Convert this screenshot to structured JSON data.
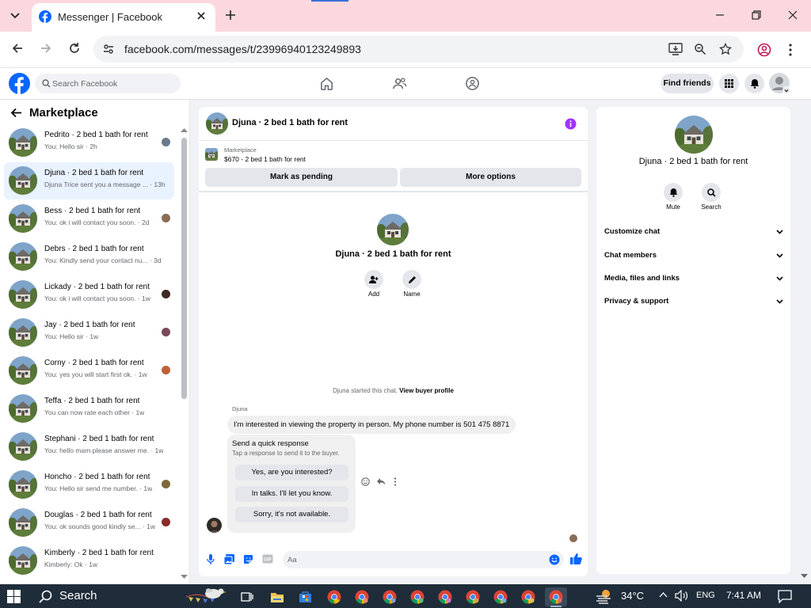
{
  "browser": {
    "tab_title": "Messenger | Facebook",
    "url": "facebook.com/messages/t/23996940123249893"
  },
  "fb_header": {
    "search_placeholder": "Search Facebook",
    "find_friends": "Find friends"
  },
  "sidebar": {
    "title": "Marketplace",
    "conversations": [
      {
        "name": "Pedrito · 2 bed 1 bath for rent",
        "preview": "You: Hello sir · 2h",
        "mini_color": "#6b7a8a"
      },
      {
        "name": "Djuna · 2 bed 1 bath for rent",
        "preview": "Djuna Trice sent you a message ... · 13h",
        "mini_color": ""
      },
      {
        "name": "Bess · 2 bed 1 bath for rent",
        "preview": "You: ok i will contact you soon. · 2d",
        "mini_color": "#8a6d56"
      },
      {
        "name": "Debrs · 2 bed 1 bath for rent",
        "preview": "You: Kindly send your contact nu... · 3d",
        "mini_color": ""
      },
      {
        "name": "Lickady · 2 bed 1 bath for rent",
        "preview": "You: ok i will contact you soon. · 1w",
        "mini_color": "#3d2a22"
      },
      {
        "name": "Jay · 2 bed 1 bath for rent",
        "preview": "You: Hello sir · 1w",
        "mini_color": "#7a4a5a"
      },
      {
        "name": "Corny · 2 bed 1 bath for rent",
        "preview": "You: yes you will start first ok. · 1w",
        "mini_color": "#c0603a"
      },
      {
        "name": "Teffa · 2 bed 1 bath for rent",
        "preview": "You can now rate each other · 1w",
        "mini_color": ""
      },
      {
        "name": "Stephani · 2 bed 1 bath for rent",
        "preview": "You: hello mam please answer me. · 1w",
        "mini_color": ""
      },
      {
        "name": "Honcho · 2 bed 1 bath for rent",
        "preview": "You: Hello sir send me number. · 1w",
        "mini_color": "#7d6a3a"
      },
      {
        "name": "Douglas · 2 bed 1 bath for rent",
        "preview": "You: ok sounds good kindly se... · 1w",
        "mini_color": "#8a2a2a"
      },
      {
        "name": "Kimberly · 2 bed 1 bath for rent",
        "preview": "Kimberly: Ok · 1w",
        "mini_color": ""
      }
    ]
  },
  "chat": {
    "title": "Djuna · 2 bed 1 bath for rent",
    "listing_category": "Marketplace",
    "listing_price": "$670 - 2 bed 1 bath for rent",
    "mark_pending": "Mark as pending",
    "more_options": "More options",
    "center_name": "Djuna · 2 bed 1 bath for rent",
    "add_label": "Add",
    "name_label": "Name",
    "started_text": "Djuna started this chat.",
    "view_profile": "View buyer profile",
    "sender": "Djuna",
    "message": "I'm interested in viewing the property in person. My phone number is 501 475 8871",
    "quick_response_title": "Send a quick response",
    "quick_response_sub": "Tap a response to send it to the buyer.",
    "quick_responses": [
      "Yes, are you interested?",
      "In talks. I'll let you know.",
      "Sorry, it's not available."
    ],
    "composer_placeholder": "Aa"
  },
  "info_panel": {
    "name": "Djuna · 2 bed 1 bath for rent",
    "mute": "Mute",
    "search": "Search",
    "sections": [
      "Customize chat",
      "Chat members",
      "Media, files and links",
      "Privacy & support"
    ]
  },
  "taskbar": {
    "search": "Search",
    "temperature": "34°C",
    "language": "ENG",
    "time": "7:41 AM"
  },
  "colors": {
    "fb_blue": "#0866ff",
    "accent_purple": "#a033ff",
    "like_blue": "#0084ff"
  }
}
